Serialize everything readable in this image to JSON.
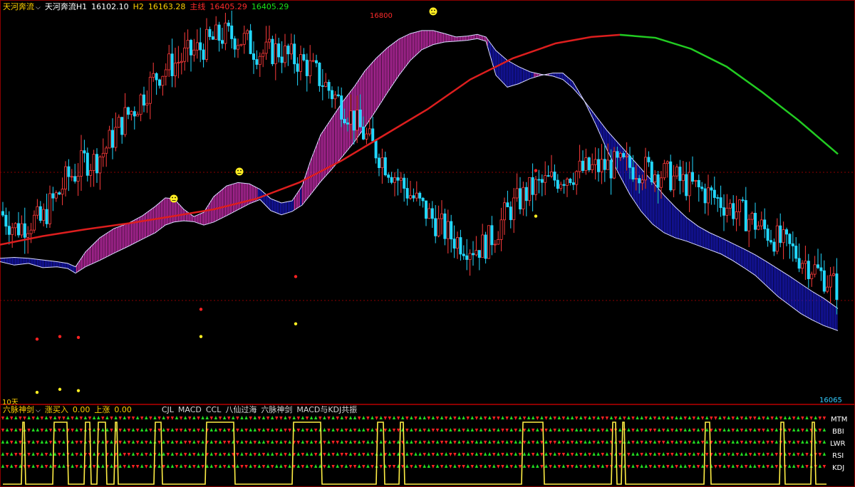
{
  "header": {
    "indicator_name": "天河奔流",
    "h1_label": "天河奔流H1",
    "h1_value": "16102.10",
    "h2_label": "H2",
    "h2_value": "16163.28",
    "main_label": "主线",
    "main_value": "16405.29",
    "extra_value": "16405.29"
  },
  "sub_header": {
    "indicator_name": "六脉神剑",
    "buy_label": "涨买入",
    "buy_value": "0.00",
    "up_label": "上涨",
    "up_value": "0.00",
    "tabs": [
      "CJL",
      "MACD",
      "CCL",
      "八仙过海",
      "六脉神剑",
      "MACD与KDJ共振"
    ]
  },
  "labels": {
    "peak_price": "16800",
    "low_price": "16065",
    "period": "10天"
  },
  "colors": {
    "cloud_up": "#e633c8",
    "cloud_down": "#1a1ad6",
    "ma_red": "#dd1e1e",
    "ma_green": "#22cc22",
    "candle_up": "#ff3b3b",
    "candle_down": "#22d8ff",
    "signal_yellow": "#ffee44",
    "sub_red": "#ff2222",
    "sub_green": "#22dd22"
  },
  "chart_data": {
    "type": "line",
    "xlabel": "",
    "ylabel": "",
    "ylim": [
      15930,
      16850
    ],
    "price_path": [
      [
        0,
        16380
      ],
      [
        10,
        16360
      ],
      [
        22,
        16340
      ],
      [
        34,
        16350
      ],
      [
        46,
        16360
      ],
      [
        58,
        16355
      ],
      [
        70,
        16395
      ],
      [
        82,
        16420
      ],
      [
        94,
        16460
      ],
      [
        106,
        16470
      ],
      [
        118,
        16500
      ],
      [
        130,
        16495
      ],
      [
        145,
        16520
      ],
      [
        160,
        16560
      ],
      [
        175,
        16600
      ],
      [
        190,
        16625
      ],
      [
        205,
        16665
      ],
      [
        220,
        16700
      ],
      [
        235,
        16720
      ],
      [
        248,
        16730
      ],
      [
        260,
        16745
      ],
      [
        278,
        16760
      ],
      [
        296,
        16780
      ],
      [
        314,
        16795
      ],
      [
        330,
        16790
      ],
      [
        345,
        16780
      ],
      [
        358,
        16760
      ],
      [
        372,
        16750
      ],
      [
        390,
        16760
      ],
      [
        403,
        16745
      ],
      [
        418,
        16735
      ],
      [
        430,
        16725
      ],
      [
        445,
        16700
      ],
      [
        460,
        16670
      ],
      [
        475,
        16640
      ],
      [
        490,
        16610
      ],
      [
        505,
        16575
      ],
      [
        520,
        16540
      ],
      [
        536,
        16505
      ],
      [
        552,
        16470
      ],
      [
        568,
        16435
      ],
      [
        584,
        16405
      ],
      [
        600,
        16375
      ],
      [
        618,
        16345
      ],
      [
        634,
        16320
      ],
      [
        650,
        16305
      ],
      [
        666,
        16295
      ],
      [
        680,
        16300
      ],
      [
        695,
        16330
      ],
      [
        710,
        16375
      ],
      [
        725,
        16400
      ],
      [
        740,
        16425
      ],
      [
        755,
        16440
      ],
      [
        770,
        16450
      ],
      [
        785,
        16460
      ],
      [
        800,
        16470
      ],
      [
        815,
        16475
      ],
      [
        830,
        16480
      ],
      [
        845,
        16485
      ],
      [
        860,
        16487
      ],
      [
        875,
        16487
      ],
      [
        890,
        16484
      ],
      [
        910,
        16478
      ],
      [
        930,
        16468
      ],
      [
        950,
        16455
      ],
      [
        970,
        16440
      ],
      [
        990,
        16425
      ],
      [
        1010,
        16405
      ],
      [
        1030,
        16385
      ],
      [
        1050,
        16365
      ],
      [
        1070,
        16340
      ],
      [
        1090,
        16315
      ],
      [
        1110,
        16290
      ],
      [
        1130,
        16263
      ],
      [
        1150,
        16235
      ],
      [
        1175,
        16200
      ]
    ],
    "cloud_upper": [
      [
        0,
        16270
      ],
      [
        20,
        16272
      ],
      [
        40,
        16270
      ],
      [
        60,
        16266
      ],
      [
        80,
        16262
      ],
      [
        95,
        16258
      ],
      [
        106,
        16250
      ],
      [
        120,
        16285
      ],
      [
        140,
        16318
      ],
      [
        160,
        16340
      ],
      [
        180,
        16352
      ],
      [
        200,
        16370
      ],
      [
        218,
        16392
      ],
      [
        232,
        16412
      ],
      [
        244,
        16410
      ],
      [
        258,
        16385
      ],
      [
        272,
        16368
      ],
      [
        286,
        16378
      ],
      [
        300,
        16415
      ],
      [
        318,
        16440
      ],
      [
        334,
        16448
      ],
      [
        350,
        16445
      ],
      [
        365,
        16432
      ],
      [
        380,
        16410
      ],
      [
        395,
        16400
      ],
      [
        410,
        16405
      ],
      [
        424,
        16440
      ],
      [
        436,
        16500
      ],
      [
        450,
        16560
      ],
      [
        466,
        16600
      ],
      [
        482,
        16640
      ],
      [
        498,
        16675
      ],
      [
        512,
        16710
      ],
      [
        528,
        16740
      ],
      [
        544,
        16765
      ],
      [
        560,
        16785
      ],
      [
        576,
        16798
      ],
      [
        592,
        16805
      ],
      [
        608,
        16805
      ],
      [
        624,
        16798
      ],
      [
        640,
        16790
      ],
      [
        656,
        16792
      ],
      [
        670,
        16796
      ],
      [
        682,
        16790
      ],
      [
        696,
        16758
      ],
      [
        712,
        16735
      ],
      [
        728,
        16720
      ],
      [
        744,
        16708
      ],
      [
        760,
        16702
      ],
      [
        776,
        16698
      ],
      [
        790,
        16690
      ],
      [
        804,
        16670
      ],
      [
        820,
        16640
      ],
      [
        836,
        16605
      ],
      [
        852,
        16570
      ],
      [
        868,
        16540
      ],
      [
        884,
        16510
      ],
      [
        900,
        16480
      ],
      [
        916,
        16450
      ],
      [
        932,
        16418
      ],
      [
        948,
        16390
      ],
      [
        964,
        16365
      ],
      [
        980,
        16345
      ],
      [
        996,
        16330
      ],
      [
        1012,
        16318
      ],
      [
        1028,
        16305
      ],
      [
        1044,
        16292
      ],
      [
        1060,
        16278
      ],
      [
        1076,
        16262
      ],
      [
        1092,
        16245
      ],
      [
        1108,
        16228
      ],
      [
        1124,
        16210
      ],
      [
        1140,
        16192
      ],
      [
        1156,
        16176
      ],
      [
        1176,
        16152
      ]
    ],
    "cloud_lower": [
      [
        0,
        16262
      ],
      [
        20,
        16254
      ],
      [
        40,
        16258
      ],
      [
        60,
        16248
      ],
      [
        80,
        16250
      ],
      [
        95,
        16246
      ],
      [
        106,
        16235
      ],
      [
        120,
        16250
      ],
      [
        140,
        16265
      ],
      [
        160,
        16282
      ],
      [
        180,
        16298
      ],
      [
        200,
        16315
      ],
      [
        218,
        16330
      ],
      [
        232,
        16348
      ],
      [
        244,
        16355
      ],
      [
        258,
        16358
      ],
      [
        272,
        16356
      ],
      [
        286,
        16348
      ],
      [
        300,
        16355
      ],
      [
        318,
        16370
      ],
      [
        334,
        16384
      ],
      [
        350,
        16398
      ],
      [
        365,
        16408
      ],
      [
        380,
        16382
      ],
      [
        395,
        16372
      ],
      [
        410,
        16380
      ],
      [
        424,
        16395
      ],
      [
        436,
        16420
      ],
      [
        450,
        16450
      ],
      [
        466,
        16480
      ],
      [
        482,
        16512
      ],
      [
        498,
        16545
      ],
      [
        512,
        16578
      ],
      [
        528,
        16618
      ],
      [
        544,
        16660
      ],
      [
        560,
        16700
      ],
      [
        576,
        16735
      ],
      [
        592,
        16760
      ],
      [
        608,
        16772
      ],
      [
        624,
        16778
      ],
      [
        640,
        16780
      ],
      [
        656,
        16782
      ],
      [
        670,
        16786
      ],
      [
        682,
        16780
      ],
      [
        696,
        16700
      ],
      [
        712,
        16672
      ],
      [
        728,
        16680
      ],
      [
        744,
        16692
      ],
      [
        760,
        16700
      ],
      [
        776,
        16705
      ],
      [
        790,
        16705
      ],
      [
        804,
        16685
      ],
      [
        820,
        16640
      ],
      [
        836,
        16585
      ],
      [
        852,
        16525
      ],
      [
        868,
        16470
      ],
      [
        884,
        16420
      ],
      [
        900,
        16380
      ],
      [
        916,
        16350
      ],
      [
        932,
        16330
      ],
      [
        948,
        16318
      ],
      [
        964,
        16310
      ],
      [
        980,
        16300
      ],
      [
        996,
        16290
      ],
      [
        1012,
        16280
      ],
      [
        1028,
        16265
      ],
      [
        1044,
        16248
      ],
      [
        1060,
        16230
      ],
      [
        1076,
        16205
      ],
      [
        1092,
        16180
      ],
      [
        1108,
        16160
      ],
      [
        1124,
        16140
      ],
      [
        1140,
        16125
      ],
      [
        1156,
        16112
      ],
      [
        1176,
        16100
      ]
    ],
    "red_dots": [
      [
        52,
        16080
      ],
      [
        84,
        16086
      ],
      [
        110,
        16084
      ],
      [
        282,
        16150
      ],
      [
        415,
        16227
      ],
      [
        752,
        16476
      ]
    ],
    "yellow_dots": [
      [
        52,
        15955
      ],
      [
        84,
        15962
      ],
      [
        110,
        15959
      ],
      [
        282,
        16086
      ],
      [
        415,
        16116
      ],
      [
        752,
        16369
      ]
    ],
    "sub_levels": [
      "MTM",
      "BBI",
      "LWR",
      "RSI",
      "KDJ"
    ],
    "signal_pulses": [
      [
        30,
        36
      ],
      [
        74,
        96
      ],
      [
        118,
        128
      ],
      [
        136,
        150
      ],
      [
        160,
        166
      ],
      [
        216,
        228
      ],
      [
        288,
        330
      ],
      [
        410,
        452
      ],
      [
        528,
        540
      ],
      [
        560,
        568
      ],
      [
        732,
        764
      ],
      [
        858,
        866
      ],
      [
        872,
        878
      ],
      [
        988,
        998
      ],
      [
        1094,
        1102
      ],
      [
        1138,
        1145
      ]
    ]
  }
}
